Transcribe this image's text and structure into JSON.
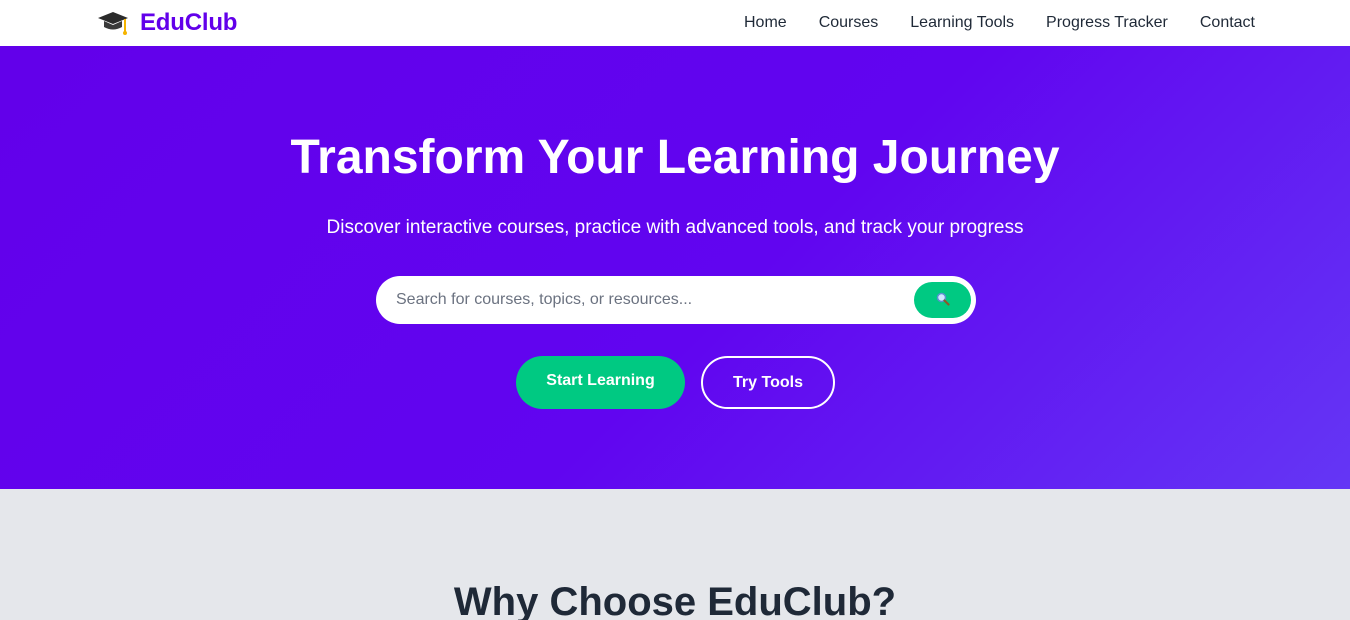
{
  "brand": {
    "name": "EduClub",
    "icon": "graduation-cap-icon",
    "color": "#6200ea"
  },
  "nav": {
    "items": [
      {
        "label": "Home"
      },
      {
        "label": "Courses"
      },
      {
        "label": "Learning Tools"
      },
      {
        "label": "Progress Tracker"
      },
      {
        "label": "Contact"
      }
    ]
  },
  "hero": {
    "title": "Transform Your Learning Journey",
    "subtitle": "Discover interactive courses, practice with advanced tools, and track your progress",
    "search": {
      "placeholder": "Search for courses, topics, or resources...",
      "value": "",
      "button_icon": "magnifier-icon"
    },
    "primary_button": "Start Learning",
    "secondary_button": "Try Tools",
    "accent_color": "#00c982"
  },
  "features": {
    "title": "Why Choose EduClub?"
  }
}
